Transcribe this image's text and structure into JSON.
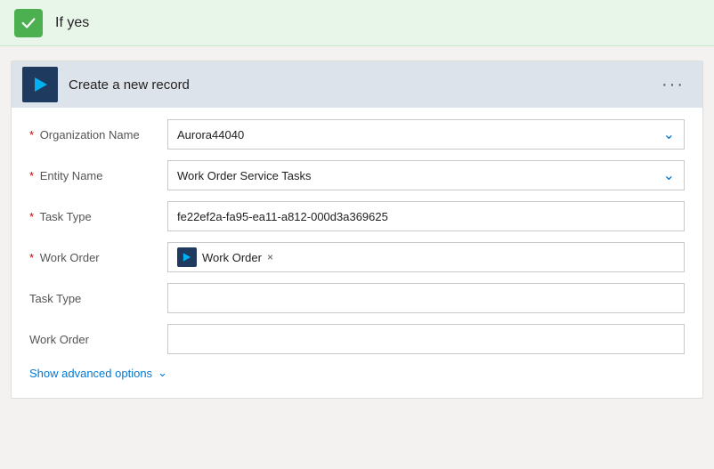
{
  "header": {
    "title": "If yes",
    "check_icon": "checkmark"
  },
  "card": {
    "title": "Create a new record",
    "menu_icon": "ellipsis",
    "icon": "play-triangle"
  },
  "form": {
    "fields": [
      {
        "label": "Organization Name",
        "required": true,
        "type": "dropdown",
        "value": "Aurora44040",
        "placeholder": ""
      },
      {
        "label": "Entity Name",
        "required": true,
        "type": "dropdown",
        "value": "Work Order Service Tasks",
        "placeholder": ""
      },
      {
        "label": "Task Type",
        "required": true,
        "type": "text",
        "value": "fe22ef2a-fa95-ea11-a812-000d3a369625",
        "placeholder": ""
      },
      {
        "label": "Work Order",
        "required": true,
        "type": "tag",
        "tag_label": "Work Order",
        "placeholder": ""
      },
      {
        "label": "Task Type",
        "required": false,
        "type": "text",
        "value": "",
        "placeholder": ""
      },
      {
        "label": "Work Order",
        "required": false,
        "type": "text",
        "value": "",
        "placeholder": ""
      }
    ]
  },
  "advanced": {
    "label": "Show advanced options"
  }
}
